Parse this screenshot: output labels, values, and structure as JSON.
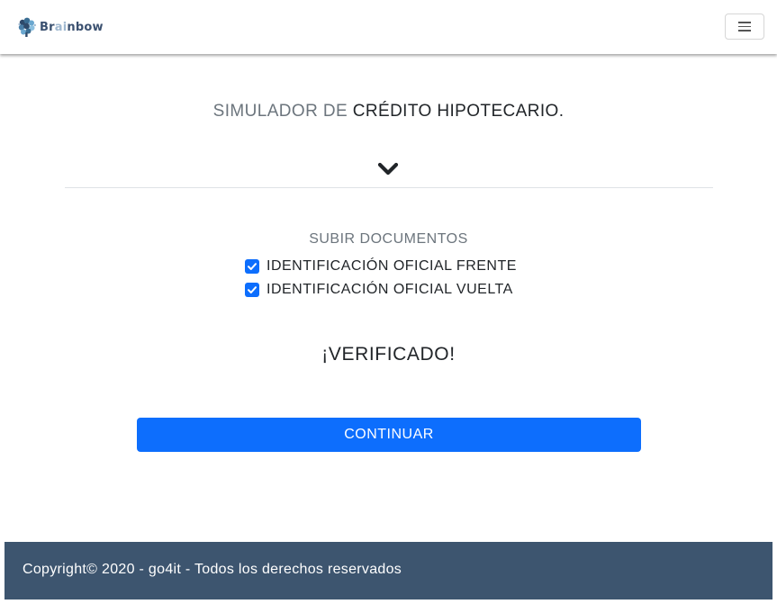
{
  "brand": {
    "name_start": "Br",
    "name_mid": "ai",
    "name_end": "nbow",
    "icon": "brain-icon",
    "color": "#3b5170"
  },
  "navbar": {
    "menu_icon": "hamburger-menu-icon"
  },
  "header": {
    "title_prefix": "SIMULADOR DE",
    "title_main": "CRÉDITO HIPOTECARIO.",
    "expand_icon": "chevron-down-icon"
  },
  "upload": {
    "title": "SUBIR DOCUMENTOS",
    "documents": [
      {
        "label": "IDENTIFICACIÓN OFICIAL FRENTE",
        "checked": true
      },
      {
        "label": "IDENTIFICACIÓN OFICIAL VUELTA",
        "checked": true
      }
    ],
    "status": "¡VERIFICADO!"
  },
  "actions": {
    "continue_label": "CONTINUAR"
  },
  "footer": {
    "text": "Copyright© 2020 - go4it - Todos los derechos reservados"
  },
  "colors": {
    "primary": "#0d6efd",
    "footer_bg": "#3d556f",
    "muted_text": "#6c757d"
  }
}
